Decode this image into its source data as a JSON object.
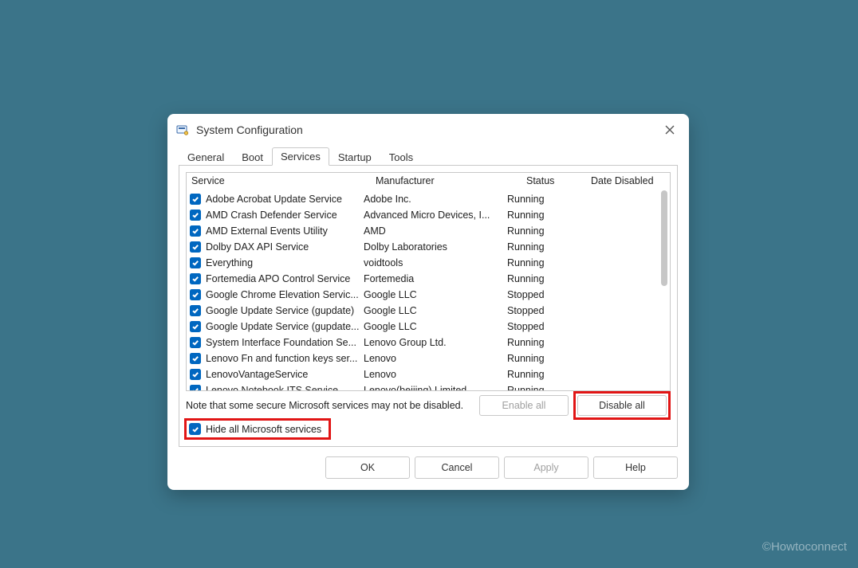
{
  "window": {
    "title": "System Configuration"
  },
  "tabs": {
    "items": [
      {
        "label": "General",
        "active": false
      },
      {
        "label": "Boot",
        "active": false
      },
      {
        "label": "Services",
        "active": true
      },
      {
        "label": "Startup",
        "active": false
      },
      {
        "label": "Tools",
        "active": false
      }
    ]
  },
  "columns": {
    "service": "Service",
    "manufacturer": "Manufacturer",
    "status": "Status",
    "date_disabled": "Date Disabled"
  },
  "services": [
    {
      "checked": true,
      "name": "Adobe Acrobat Update Service",
      "manufacturer": "Adobe Inc.",
      "status": "Running"
    },
    {
      "checked": true,
      "name": "AMD Crash Defender Service",
      "manufacturer": "Advanced Micro Devices, I...",
      "status": "Running"
    },
    {
      "checked": true,
      "name": "AMD External Events Utility",
      "manufacturer": "AMD",
      "status": "Running"
    },
    {
      "checked": true,
      "name": "Dolby DAX API Service",
      "manufacturer": "Dolby Laboratories",
      "status": "Running"
    },
    {
      "checked": true,
      "name": "Everything",
      "manufacturer": "voidtools",
      "status": "Running"
    },
    {
      "checked": true,
      "name": "Fortemedia APO Control Service",
      "manufacturer": "Fortemedia",
      "status": "Running"
    },
    {
      "checked": true,
      "name": "Google Chrome Elevation Servic...",
      "manufacturer": "Google LLC",
      "status": "Stopped"
    },
    {
      "checked": true,
      "name": "Google Update Service (gupdate)",
      "manufacturer": "Google LLC",
      "status": "Stopped"
    },
    {
      "checked": true,
      "name": "Google Update Service (gupdate...",
      "manufacturer": "Google LLC",
      "status": "Stopped"
    },
    {
      "checked": true,
      "name": "System Interface Foundation Se...",
      "manufacturer": "Lenovo Group Ltd.",
      "status": "Running"
    },
    {
      "checked": true,
      "name": "Lenovo Fn and function keys ser...",
      "manufacturer": "Lenovo",
      "status": "Running"
    },
    {
      "checked": true,
      "name": "LenovoVantageService",
      "manufacturer": "Lenovo",
      "status": "Running"
    },
    {
      "checked": true,
      "name": "Lenovo Notebook ITS Service",
      "manufacturer": "Lenovo(beijing) Limited",
      "status": "Running"
    }
  ],
  "note": "Note that some secure Microsoft services may not be disabled.",
  "buttons": {
    "enable_all": "Enable all",
    "disable_all": "Disable all",
    "ok": "OK",
    "cancel": "Cancel",
    "apply": "Apply",
    "help": "Help"
  },
  "hide_ms": {
    "checked": true,
    "label": "Hide all Microsoft services"
  },
  "watermark": "©Howtoconnect"
}
